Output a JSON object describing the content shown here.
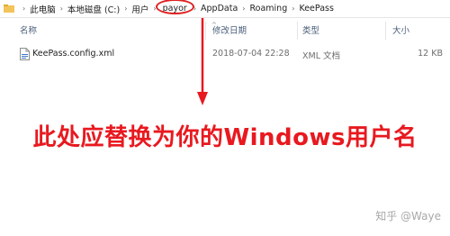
{
  "address_bar": {
    "crumbs": [
      "此电脑",
      "本地磁盘 (C:)",
      "用户",
      "payor",
      "AppData",
      "Roaming",
      "KeePass"
    ],
    "separator": "›"
  },
  "columns": {
    "name": "名称",
    "date": "修改日期",
    "type": "类型",
    "size": "大小"
  },
  "files": [
    {
      "name": "KeePass.config.xml",
      "modified": "2018-07-04 22:28",
      "type": "XML 文档",
      "size": "12 KB"
    }
  ],
  "annotation": {
    "text": "此处应替换为你的Windows用户名",
    "color": "#e8191f"
  },
  "watermark": "知乎 @Waye"
}
